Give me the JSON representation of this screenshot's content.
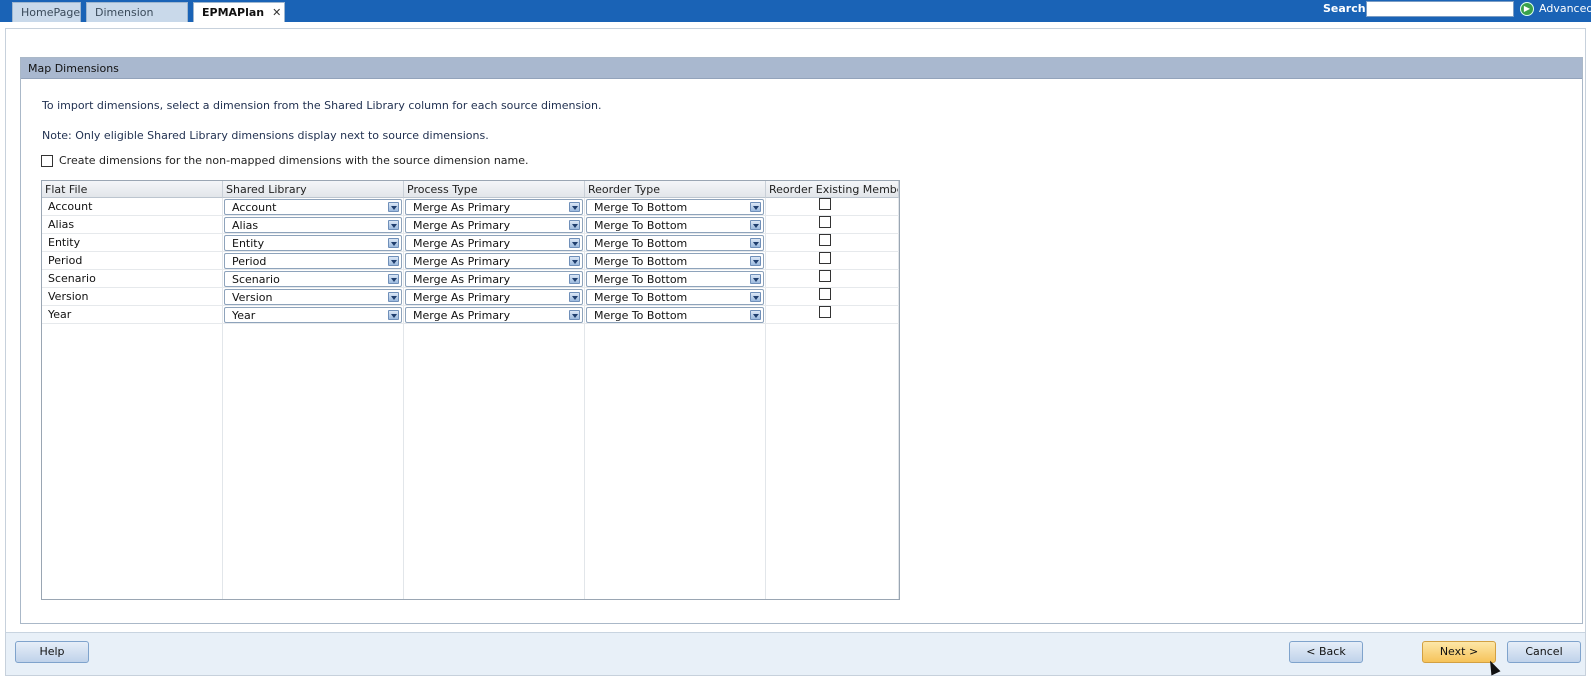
{
  "tabs": [
    {
      "label": "HomePage",
      "active": false
    },
    {
      "label": "Dimension Library",
      "active": false
    },
    {
      "label": "EPMAPlan",
      "active": true,
      "closable": true
    }
  ],
  "search": {
    "label": "Search:",
    "value": "",
    "advanced_label": "Advanced",
    "advanced_icon": "play-circle-icon"
  },
  "panel": {
    "title": "Map Dimensions",
    "instruction": "To import dimensions, select a dimension from the Shared Library column for each source dimension.",
    "note": "Note: Only eligible Shared Library dimensions display next to source dimensions.",
    "create_checkbox_label": "Create dimensions for the non-mapped dimensions with the source dimension name.",
    "create_checked": false
  },
  "grid": {
    "columns": [
      "Flat File",
      "Shared Library",
      "Process Type",
      "Reorder Type",
      "Reorder Existing Members"
    ],
    "rows": [
      {
        "flat_file": "Account",
        "shared_library": "Account",
        "process_type": "Merge As Primary",
        "reorder_type": "Merge To Bottom",
        "reorder_existing": false
      },
      {
        "flat_file": "Alias",
        "shared_library": "Alias",
        "process_type": "Merge As Primary",
        "reorder_type": "Merge To Bottom",
        "reorder_existing": false
      },
      {
        "flat_file": "Entity",
        "shared_library": "Entity",
        "process_type": "Merge As Primary",
        "reorder_type": "Merge To Bottom",
        "reorder_existing": false
      },
      {
        "flat_file": "Period",
        "shared_library": "Period",
        "process_type": "Merge As Primary",
        "reorder_type": "Merge To Bottom",
        "reorder_existing": false
      },
      {
        "flat_file": "Scenario",
        "shared_library": "Scenario",
        "process_type": "Merge As Primary",
        "reorder_type": "Merge To Bottom",
        "reorder_existing": false
      },
      {
        "flat_file": "Version",
        "shared_library": "Version",
        "process_type": "Merge As Primary",
        "reorder_type": "Merge To Bottom",
        "reorder_existing": false
      },
      {
        "flat_file": "Year",
        "shared_library": "Year",
        "process_type": "Merge As Primary",
        "reorder_type": "Merge To Bottom",
        "reorder_existing": false
      }
    ]
  },
  "footer": {
    "help": "Help",
    "back": "< Back",
    "next": "Next >",
    "cancel": "Cancel"
  },
  "colors": {
    "topbar": "#1a63b6",
    "panel_header": "#a9b8cf",
    "footer_bg": "#e8f0f8",
    "primary_button": "#f6c35a"
  }
}
